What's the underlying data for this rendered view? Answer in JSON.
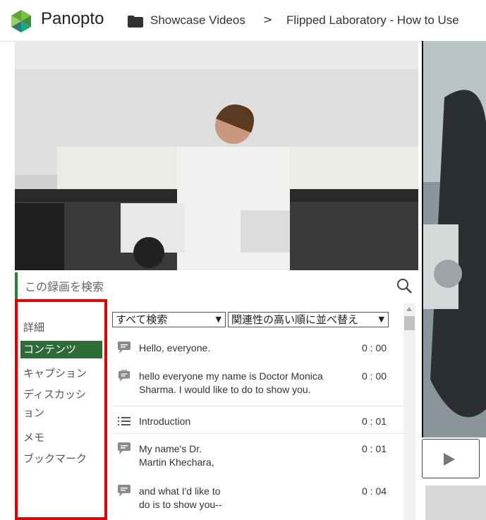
{
  "header": {
    "brand": "Panopto",
    "breadcrumb_folder": "Showcase Videos",
    "breadcrumb_separator": ">",
    "breadcrumb_title": "Flipped Laboratory - How to Use"
  },
  "search": {
    "placeholder": "この録画を検索"
  },
  "nav": {
    "items": [
      {
        "label": "詳細"
      },
      {
        "label": "コンテンツ"
      },
      {
        "label": "キャプション"
      },
      {
        "label": "ディスカッシ"
      },
      {
        "label": "ョン"
      },
      {
        "label": "メモ"
      },
      {
        "label": "ブックマーク"
      }
    ],
    "active": "コンテンツ",
    "highlight_color": "#e00000"
  },
  "filters": {
    "scope_select": "すべて検索",
    "sort_select": "関連性の高い順に並べ替え"
  },
  "contents": [
    {
      "icon": "speech-bubble-icon",
      "text": "Hello, everyone.",
      "time": "0 : 00"
    },
    {
      "icon": "caption-bubble-icon",
      "text": "hello everyone my name is Doctor Monica\nSharma. I would like to do to show you.",
      "time": "0 : 00"
    },
    {
      "icon": "list-icon",
      "text": "Introduction",
      "time": "0 : 01"
    },
    {
      "icon": "speech-bubble-icon",
      "text": "My name's Dr.\nMartin Khechara,",
      "time": "0 : 01"
    },
    {
      "icon": "speech-bubble-icon",
      "text": "and what I'd like to\ndo is to show you--",
      "time": "0 : 04"
    }
  ],
  "colors": {
    "accent_green": "#2e6b36",
    "search_bar_accent": "#2e7d32",
    "logo_green": "#7cc242",
    "logo_teal": "#1fa48c"
  }
}
